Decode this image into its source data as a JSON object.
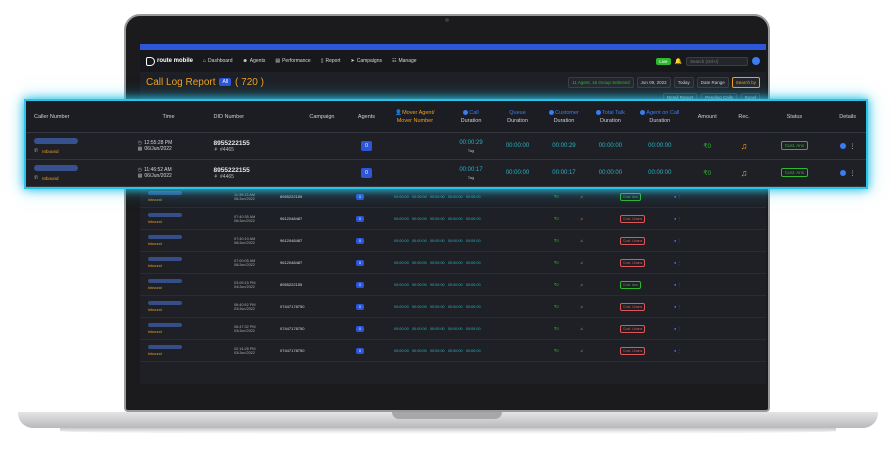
{
  "navbar": {
    "logo": "route mobile",
    "items": [
      "Dashboard",
      "Agents",
      "Performance",
      "Report",
      "Campaigns",
      "Manage"
    ],
    "live": "Live",
    "search_placeholder": "Search (ctrl+/)"
  },
  "titlebar": {
    "title": "Call Log Report",
    "all_label": "All",
    "count": "( 720 )",
    "filter_agents": "11 Agent, 16 Group Selected",
    "date": "Jun 09, 2022",
    "today": "Today",
    "date_range": "Date Range",
    "search_by": "Search by"
  },
  "subbar": {
    "detail_report": "Detail Report",
    "pending_calls": "Pending Calls",
    "excel": "Excel"
  },
  "table": {
    "headers": {
      "caller": "Caller Number",
      "time": "Time",
      "did": "DID Number",
      "campaign": "Campaign",
      "agents": "Agents",
      "mover_agent": "Mover Agent/",
      "mover_number": "Mover Number",
      "call": "Call",
      "queue": "Queue",
      "customer": "Customer",
      "total_talk": "Total Talk",
      "agent_on_call": "Agent on Call",
      "duration": "Duration",
      "amount": "Amount",
      "rec": "Rec.",
      "status": "Status",
      "details": "Details"
    },
    "rows": [
      {
        "caller_type": "Inbound",
        "time": "12:55:28 PM",
        "date": "06/Jun/2022",
        "did": "8955222155",
        "did_sub": "#4465",
        "agents": "0",
        "call": "00:00:29",
        "tag": "Tag",
        "queue": "00:00:00",
        "customer": "00:00:29",
        "total_talk": "00:00:00",
        "agent_on_call": "00:00:00",
        "amount": "0",
        "status": "Cust. Ans"
      },
      {
        "caller_type": "Inbound",
        "time": "11:46:52 AM",
        "date": "06/Jun/2022",
        "did": "8955222155",
        "did_sub": "#4465",
        "agents": "0",
        "call": "00:00:17",
        "tag": "Tag",
        "queue": "00:00:00",
        "customer": "00:00:17",
        "total_talk": "00:00:00",
        "agent_on_call": "00:00:00",
        "amount": "0",
        "status": "Cust. Ans"
      }
    ],
    "bg_rows": [
      {
        "inb": "Inbound",
        "time": "11:39:13 AM",
        "date": "06/Jun/2022",
        "did": "8955222155",
        "agents": "0",
        "amount": "0",
        "status": "Cust. Ans"
      },
      {
        "inb": "Inbound",
        "time": "07:40:35 AM",
        "date": "06/Jun/2022",
        "did": "9612048487",
        "agents": "0",
        "amount": "0",
        "status": "Cust. Unans"
      },
      {
        "inb": "Inbound",
        "time": "07:40:19 AM",
        "date": "06/Jun/2022",
        "did": "9612048487",
        "agents": "0",
        "amount": "0",
        "status": "Cust. Unans"
      },
      {
        "inb": "Inbound",
        "time": "07:00:05 AM",
        "date": "06/Jun/2022",
        "did": "9612048487",
        "agents": "0",
        "amount": "0",
        "status": "Cust. Unans"
      },
      {
        "inb": "Inbound",
        "time": "03:09:15 PM",
        "date": "04/Jun/2022",
        "did": "8955222155",
        "agents": "0",
        "amount": "0",
        "status": "Cust. Ans"
      },
      {
        "inb": "Inbound",
        "time": "06:40:52 PM",
        "date": "03/Jun/2022",
        "did": "07447178750",
        "agents": "0",
        "amount": "0",
        "status": "Cust. Unans"
      },
      {
        "inb": "Inbound",
        "time": "06:47:32 PM",
        "date": "03/Jun/2022",
        "did": "07447178750",
        "agents": "0",
        "amount": "0",
        "status": "Cust. Unans"
      },
      {
        "inb": "Inbound",
        "time": "02:14:28 PM",
        "date": "03/Jun/2022",
        "did": "07447178750",
        "agents": "0",
        "amount": "0",
        "status": "Cust. Unans"
      }
    ]
  },
  "colors": {
    "accent": "#f0a020",
    "teal": "#2ab3c4",
    "blue": "#2d56d8",
    "green": "#2eb82e",
    "highlight": "#2bc3e8"
  }
}
